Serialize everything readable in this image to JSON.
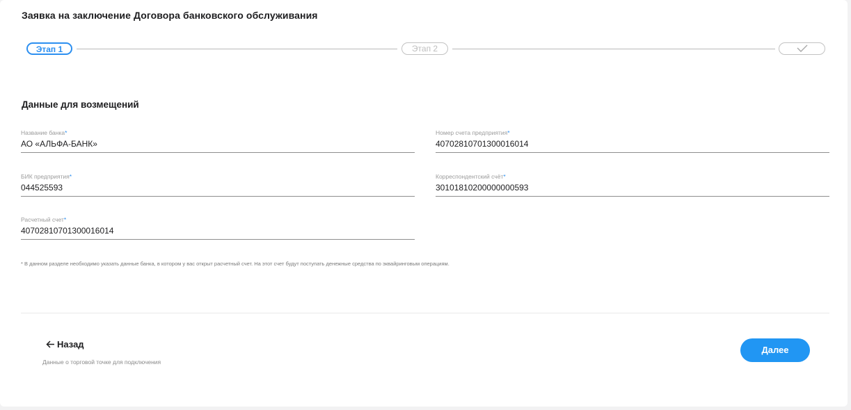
{
  "page": {
    "title": "Заявка на заключение Договора банковского обслуживания"
  },
  "stepper": {
    "steps": [
      {
        "label": "Этап 1",
        "state": "active"
      },
      {
        "label": "Этап 2",
        "state": "inactive"
      },
      {
        "label": "",
        "icon": "checkmark-icon",
        "state": "inactive"
      }
    ],
    "active_color": "#2c8ff0"
  },
  "section": {
    "title": "Данные для возмещений"
  },
  "fields": {
    "bank_name": {
      "label": "Название банка",
      "required": "*",
      "value": "АО «АЛЬФА-БАНК»"
    },
    "account_number": {
      "label": "Номер счета предприятия",
      "required": "*",
      "value": "40702810701300016014"
    },
    "bik": {
      "label": "БИК предприятия",
      "required": "*",
      "value": "044525593"
    },
    "correspondent_account": {
      "label": "Корреспондентский счёт",
      "required": "*",
      "value": "30101810200000000593"
    },
    "settlement_account": {
      "label": "Расчетный счет",
      "required": "*",
      "value": "40702810701300016014"
    }
  },
  "footnote": "* В данном разделе необходимо указать данные банка, в котором у вас открыт расчетный счет. На этот счет будут поступать денежные средства по эквайринговым операциям.",
  "navigation": {
    "back_label": "Назад",
    "back_icon": "arrow-left-icon",
    "back_subtitle": "Данные о торговой точке для подключения",
    "next_label": "Далее",
    "next_color": "#2196f3"
  }
}
